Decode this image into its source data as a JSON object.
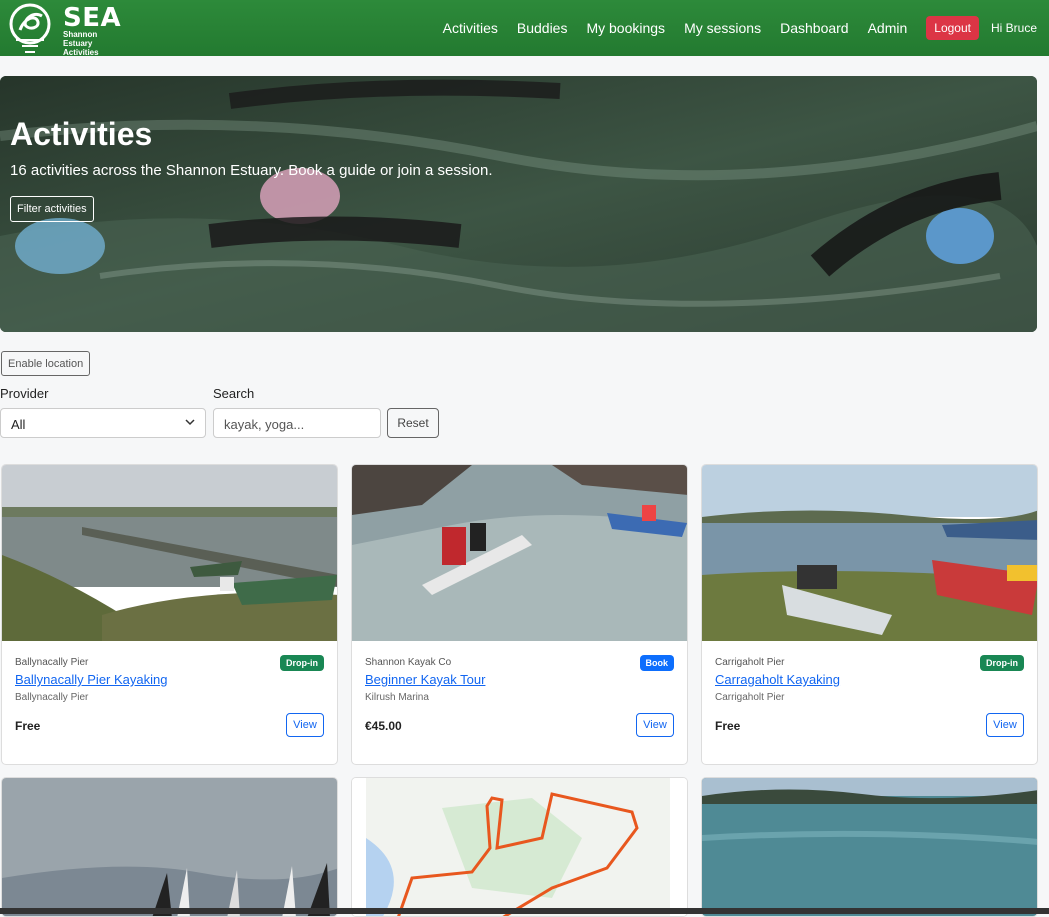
{
  "brand": {
    "name": "SEA",
    "sub_line1": "Shannon",
    "sub_line2": "Estuary Activities"
  },
  "nav": {
    "items": [
      "Activities",
      "Buddies",
      "My bookings",
      "My sessions",
      "Dashboard",
      "Admin"
    ],
    "logout": "Logout",
    "greeting": "Hi Bruce"
  },
  "hero": {
    "title": "Activities",
    "subtitle": "16 activities across the Shannon Estuary. Book a guide or join a session.",
    "filter_button": "Filter activities"
  },
  "location_button": "Enable location",
  "filters": {
    "provider_label": "Provider",
    "provider_value": "All",
    "search_label": "Search",
    "search_placeholder": "kayak, yoga...",
    "reset": "Reset"
  },
  "cards": [
    {
      "provider": "Ballynacally Pier",
      "badge": "Drop-in",
      "badge_color": "#198754",
      "title": "Ballynacally Pier Kayaking",
      "location": "Ballynacally Pier",
      "price": "Free",
      "view": "View"
    },
    {
      "provider": "Shannon Kayak Co",
      "badge": "Book",
      "badge_color": "#0d6efd",
      "title": "Beginner Kayak Tour",
      "location": "Kilrush Marina",
      "price": "€45.00",
      "view": "View"
    },
    {
      "provider": "Carrigaholt Pier",
      "badge": "Drop-in",
      "badge_color": "#198754",
      "title": "Carragaholt Kayaking",
      "location": "Carrigaholt Pier",
      "price": "Free",
      "view": "View"
    }
  ],
  "colors": {
    "nav": "#2d8a3a",
    "logout": "#dc3545",
    "link": "#1266f1"
  }
}
